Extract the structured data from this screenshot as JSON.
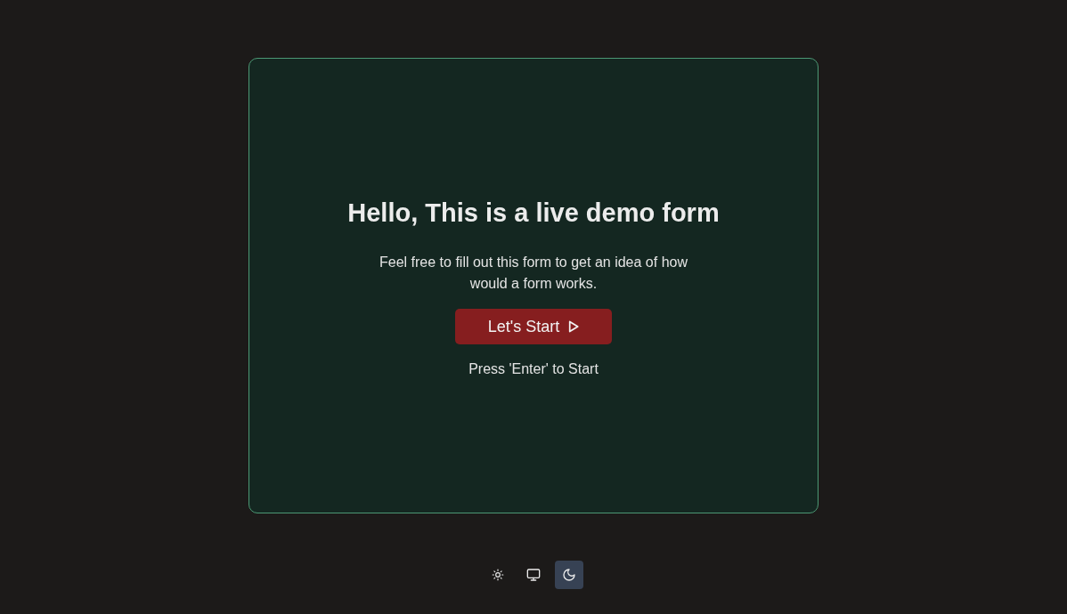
{
  "card": {
    "title": "Hello, This is a live demo form",
    "description": "Feel free to fill out this form to get an idea of how would a form works.",
    "start_button": {
      "label": "Let's Start"
    },
    "hint": "Press 'Enter' to Start"
  },
  "theme_switcher": [
    {
      "kind": "light",
      "selected": false
    },
    {
      "kind": "system",
      "selected": false
    },
    {
      "kind": "dark",
      "selected": true
    }
  ]
}
